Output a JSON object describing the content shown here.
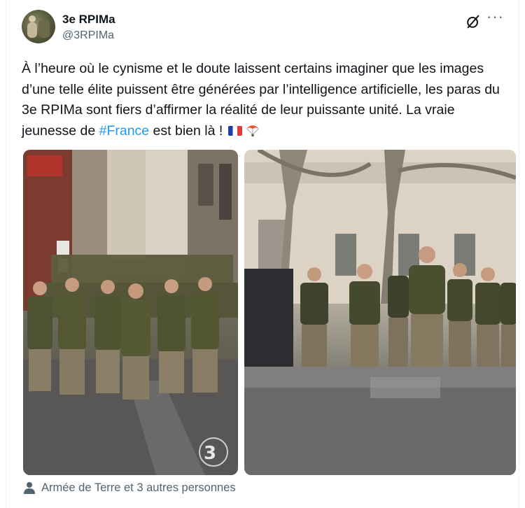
{
  "author": {
    "name": "3e RPIMa",
    "handle": "@3RPIMa"
  },
  "header_icons": [
    "grok-icon",
    "more-options-icon"
  ],
  "more_glyph": "···",
  "post": {
    "text_before": "À l’heure où le cynisme et le doute laissent certains imaginer que les images d’une telle élite puissent être générées par l’intelligence artificielle, les paras du 3e RPIMa sont fiers d’affirmer la réalité de leur puissante unité. La vraie jeunesse de ",
    "hashtag": "#France",
    "text_after": " est bien là ! ",
    "emojis": [
      "flag-france-icon",
      "parachute-icon"
    ]
  },
  "media": {
    "left_logo_text": "3",
    "images": [
      {
        "kind": "photo",
        "subject": "soldiers marching in street"
      },
      {
        "kind": "photo",
        "subject": "soldiers marching on square"
      }
    ]
  },
  "likes": {
    "label": "Armée de Terre et 3 autres personnes"
  },
  "colors": {
    "text": "#0f1419",
    "secondary": "#536471",
    "link": "#1d9bf0",
    "border": "#eff3f4"
  }
}
